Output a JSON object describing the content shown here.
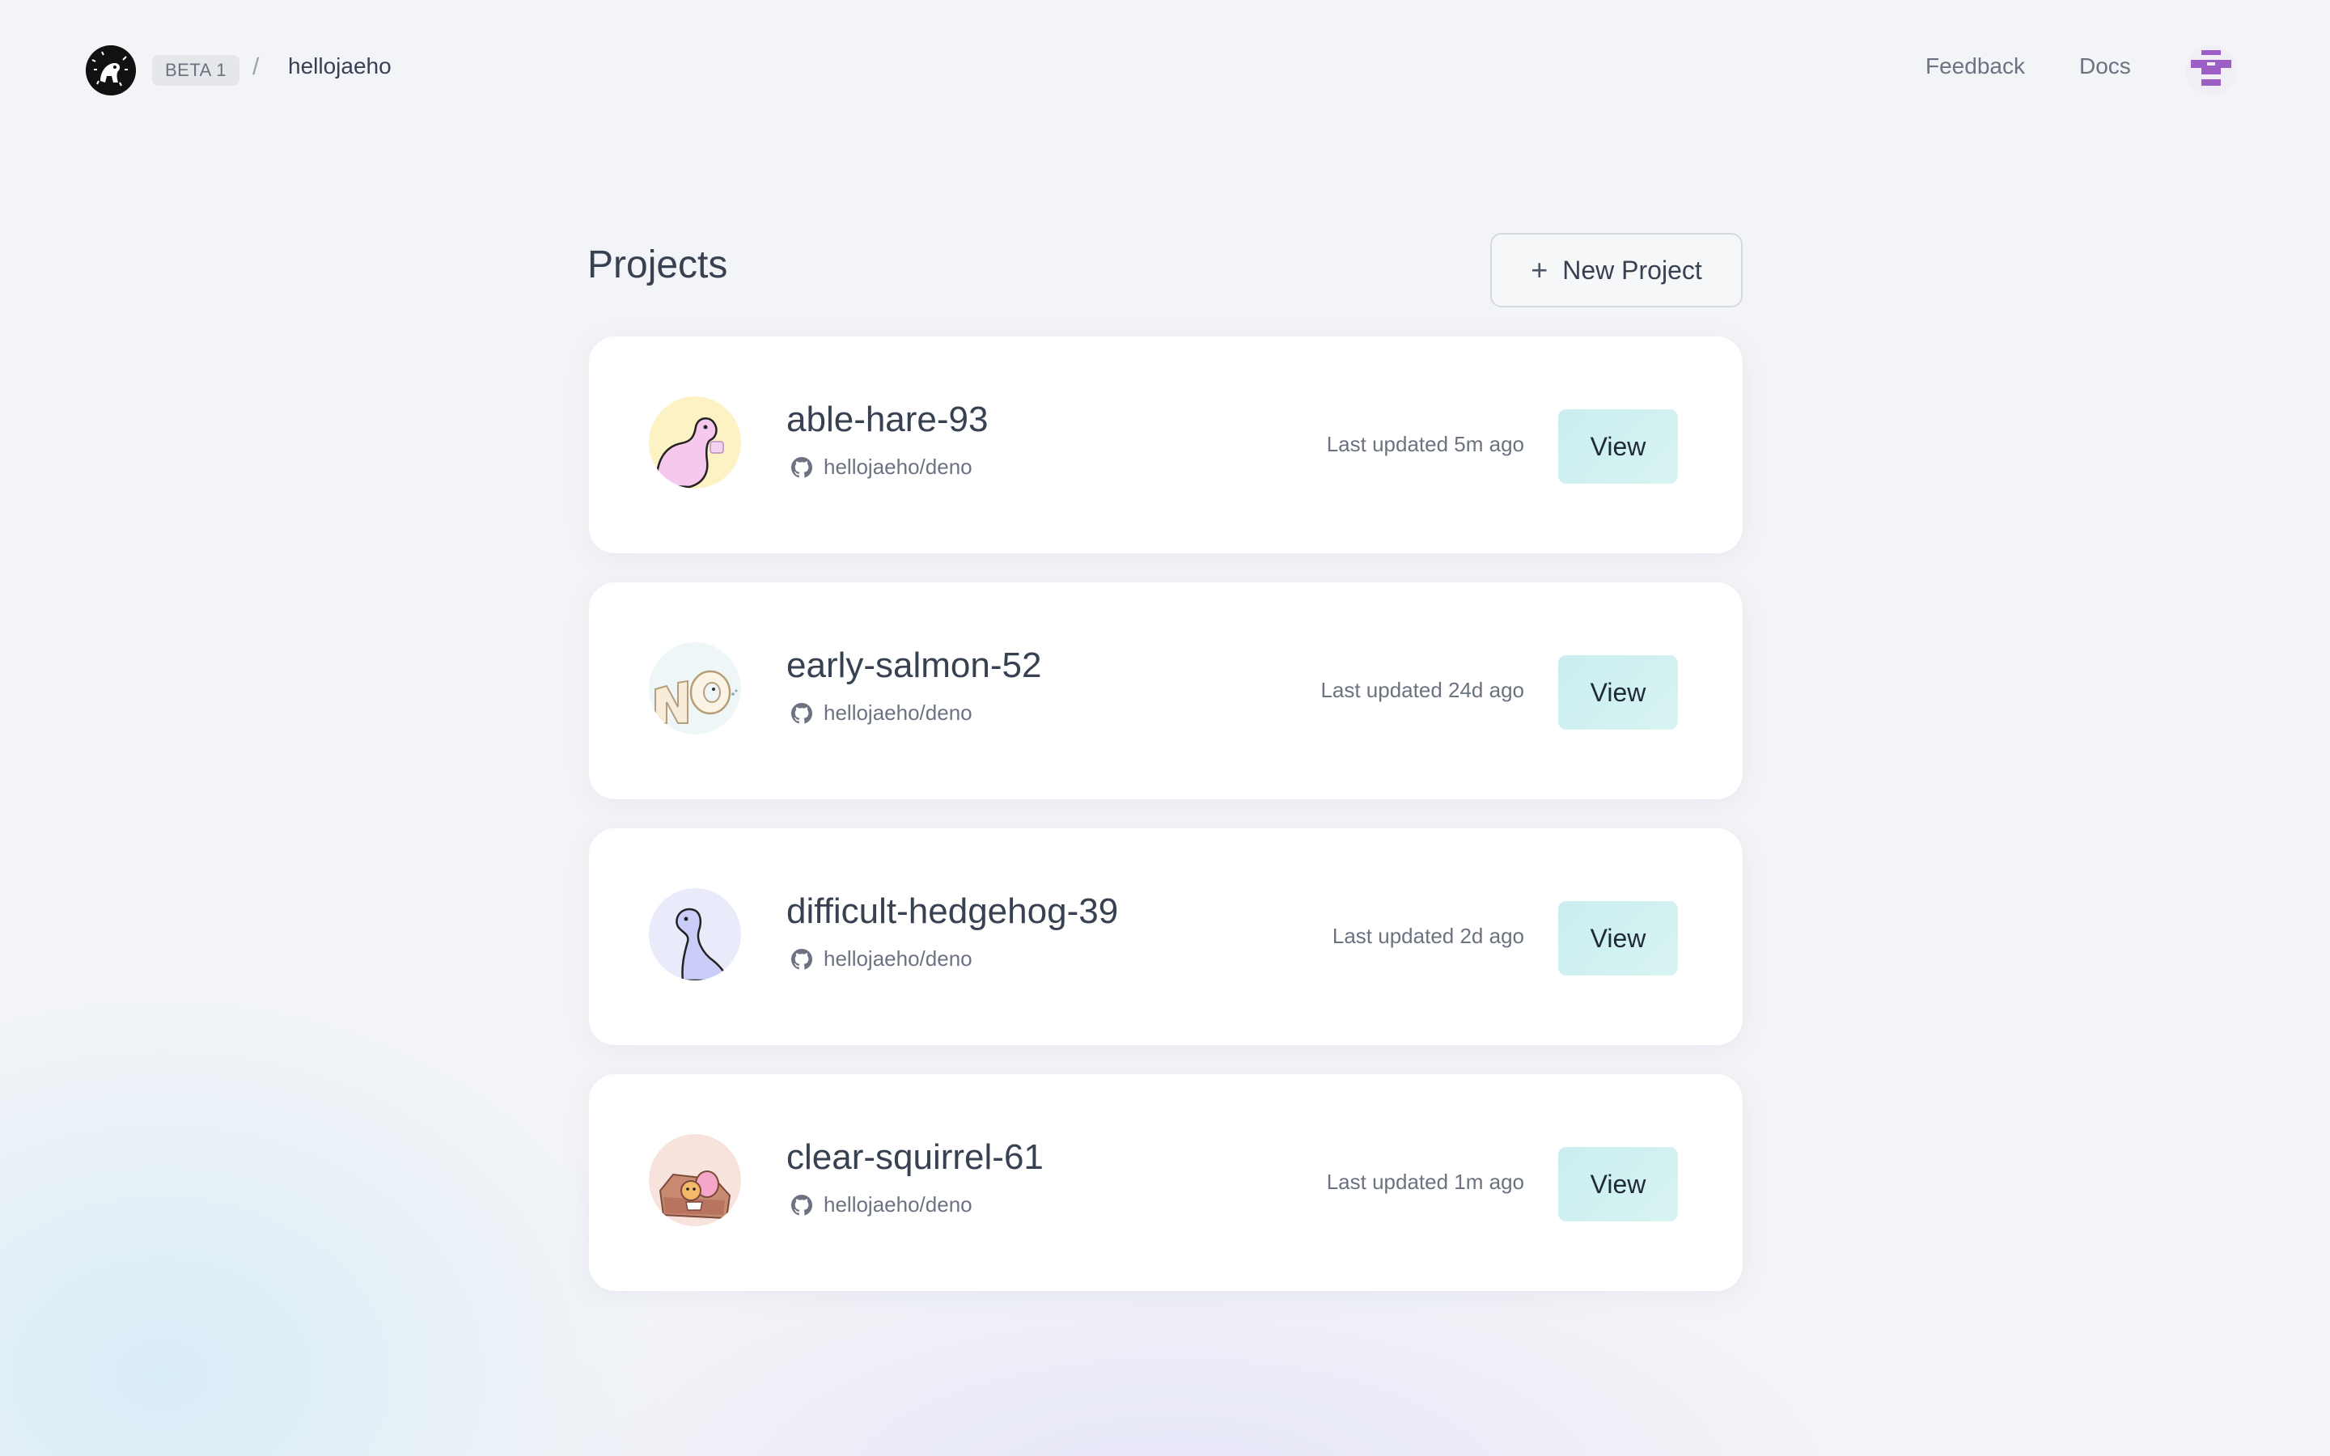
{
  "header": {
    "badge": "BETA 1",
    "separator": "/",
    "org_name": "hellojaeho",
    "nav": {
      "feedback": "Feedback",
      "docs": "Docs"
    },
    "avatar_color": "#9b5fc6"
  },
  "main": {
    "title": "Projects",
    "new_project": {
      "icon": "plus-icon",
      "label": "New Project"
    },
    "projects": [
      {
        "name": "able-hare-93",
        "repo": "hellojaeho/deno",
        "updated": "Last updated 5m ago",
        "view_label": "View",
        "avatar_bg": "#fdf2c4"
      },
      {
        "name": "early-salmon-52",
        "repo": "hellojaeho/deno",
        "updated": "Last updated 24d ago",
        "view_label": "View",
        "avatar_bg": "#eef6f8"
      },
      {
        "name": "difficult-hedgehog-39",
        "repo": "hellojaeho/deno",
        "updated": "Last updated 2d ago",
        "view_label": "View",
        "avatar_bg": "#e9ebfb"
      },
      {
        "name": "clear-squirrel-61",
        "repo": "hellojaeho/deno",
        "updated": "Last updated 1m ago",
        "view_label": "View",
        "avatar_bg": "#f8e3dc"
      }
    ]
  },
  "colors": {
    "view_button": "#c9eef0",
    "page_bg": "#f3f4f7",
    "card_bg": "#ffffff"
  }
}
